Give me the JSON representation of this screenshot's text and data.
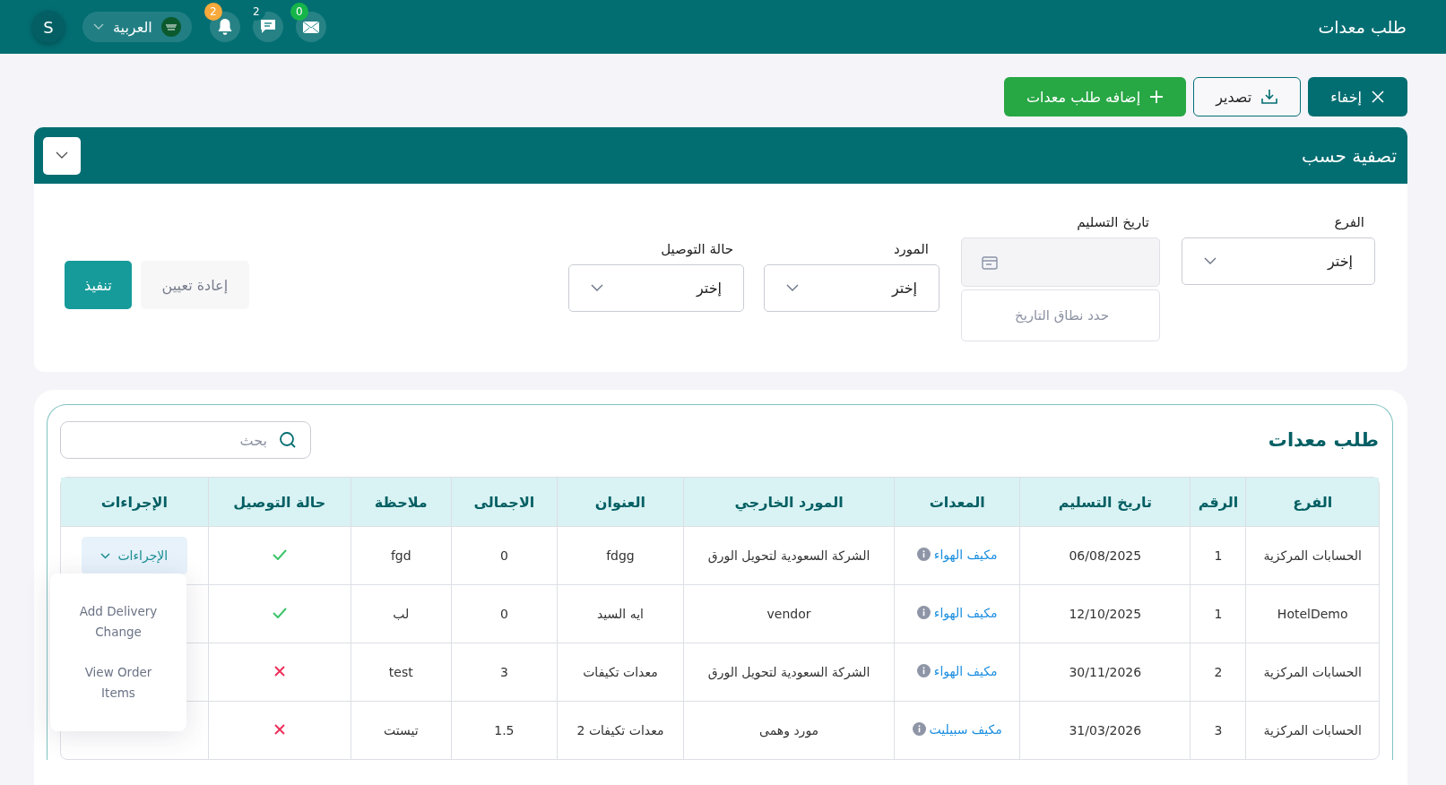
{
  "header": {
    "title": "طلب معدات",
    "avatar": "S",
    "language": "العربية",
    "notifications": [
      {
        "kind": "mail",
        "count": "0",
        "color": "#16b54a"
      },
      {
        "kind": "chat",
        "count": "2",
        "color": "#036e72"
      },
      {
        "kind": "bell",
        "count": "2",
        "color": "#f7a93b"
      }
    ]
  },
  "toolbar": [
    {
      "kind": "hide",
      "label": "إخفاء"
    },
    {
      "kind": "export",
      "label": "تصدير"
    },
    {
      "kind": "add",
      "label": "إضافه طلب معدات"
    }
  ],
  "filter": {
    "title": "تصفية حسب",
    "expanded": true,
    "fields": [
      {
        "kind": "select",
        "label": "الفرع",
        "value": "إختر"
      },
      {
        "kind": "date",
        "label": "تاريخ التسليم",
        "placeholder": "حدد نطاق التاريخ"
      },
      {
        "kind": "select",
        "label": "المورد",
        "value": "إختر"
      },
      {
        "kind": "select",
        "label": "حالة التوصيل",
        "value": "إختر"
      }
    ],
    "reset": "إعادة تعيين",
    "apply": "تنفيذ"
  },
  "table": {
    "title": "طلب معدات",
    "search": {
      "placeholder": "بحث"
    },
    "columns": [
      "الفرع",
      "الرقم",
      "تاريخ التسليم",
      "المعدات",
      "المورد الخارجي",
      "العنوان",
      "الاجمالى",
      "ملاحظة",
      "حالة التوصيل",
      "الإجراءات"
    ],
    "rows": [
      {
        "branch": "الحسابات المركزية",
        "number": "1",
        "date": "06/08/2025",
        "equipment": "مكيف الهواء",
        "supplier": "الشركة السعودية لتحويل الورق",
        "address": "fdgg",
        "total": "0",
        "note": "fgd",
        "delivered": true,
        "action": "الإجراءات"
      },
      {
        "branch": "HotelDemo",
        "number": "1",
        "date": "12/10/2025",
        "equipment": "مكيف الهواء",
        "supplier": "vendor",
        "address": "ايه السيد",
        "total": "0",
        "note": "لب",
        "delivered": true
      },
      {
        "branch": "الحسابات المركزية",
        "number": "2",
        "date": "30/11/2026",
        "equipment": "مكيف الهواء",
        "supplier": "الشركة السعودية لتحويل الورق",
        "address": "معدات تكيفات",
        "total": "3",
        "note": "test",
        "delivered": false
      },
      {
        "branch": "الحسابات المركزية",
        "number": "3",
        "date": "31/03/2026",
        "equipment": "مكيف سبيليت",
        "supplier": "مورد وهمى",
        "address": "معدات تكيفات 2",
        "total": "1.5",
        "note": "تيستت",
        "delivered": false
      }
    ],
    "action_menu": [
      "Add Delivery Change",
      "View Order Items"
    ]
  }
}
